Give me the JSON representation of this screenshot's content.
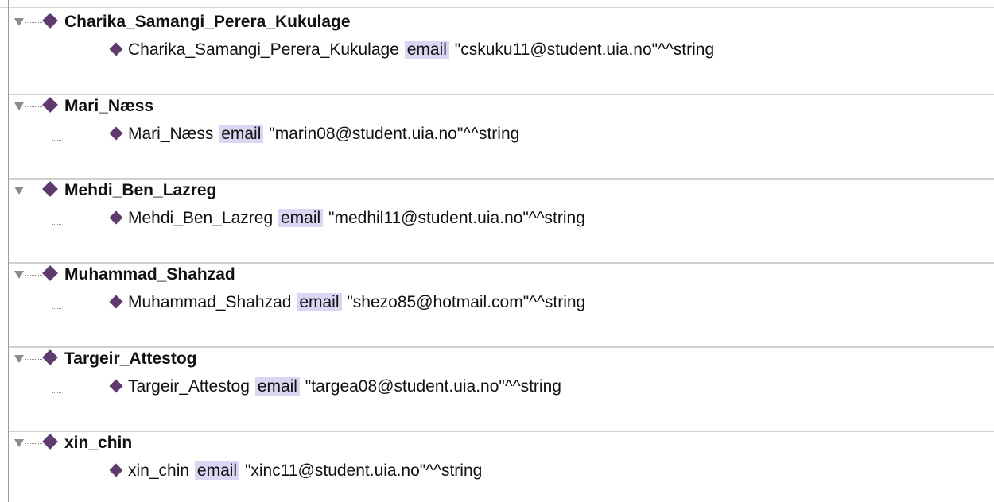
{
  "individuals": [
    {
      "name": "Charika_Samangi_Perera_Kukulage",
      "subject": "Charika_Samangi_Perera_Kukulage",
      "property": "email",
      "value": "\"cskuku11@student.uia.no\"^^string"
    },
    {
      "name": "Mari_Næss",
      "subject": "Mari_Næss",
      "property": "email",
      "value": "\"marin08@student.uia.no\"^^string"
    },
    {
      "name": "Mehdi_Ben_Lazreg",
      "subject": "Mehdi_Ben_Lazreg",
      "property": "email",
      "value": "\"medhil11@student.uia.no\"^^string"
    },
    {
      "name": "Muhammad_Shahzad",
      "subject": "Muhammad_Shahzad",
      "property": "email",
      "value": "\"shezo85@hotmail.com\"^^string"
    },
    {
      "name": "Targeir_Attestog",
      "subject": "Targeir_Attestog",
      "property": "email",
      "value": "\"targea08@student.uia.no\"^^string"
    },
    {
      "name": "xin_chin",
      "subject": "xin_chin",
      "property": "email",
      "value": "\"xinc11@student.uia.no\"^^string"
    }
  ],
  "colors": {
    "individual_marker": "#5e3a6e",
    "property_highlight": "#d8d6f0",
    "separator": "#cfcfcf"
  },
  "icons": {
    "expand_toggle": "triangle-down-icon",
    "individual": "diamond-icon"
  }
}
